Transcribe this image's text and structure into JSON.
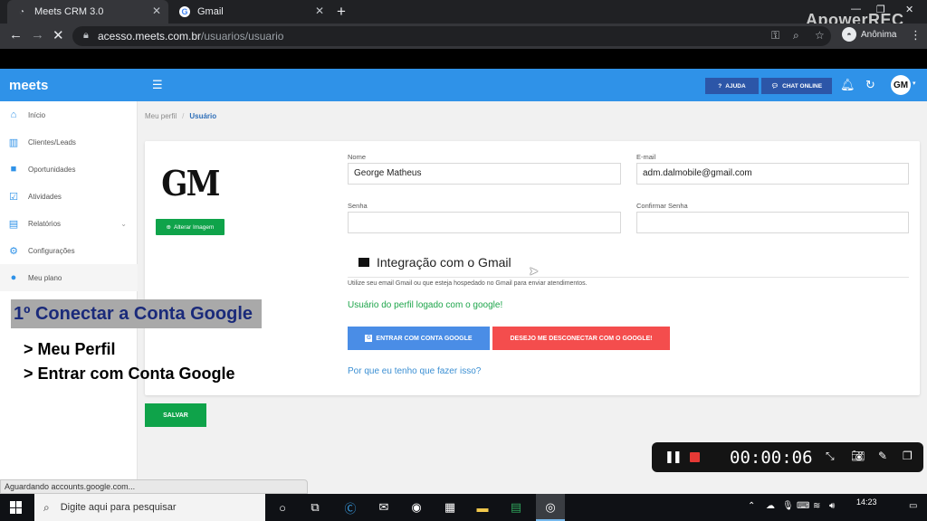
{
  "browser": {
    "tabs": [
      {
        "title": "Meets CRM 3.0"
      },
      {
        "title": "Gmail"
      }
    ],
    "url_host": "acesso.meets.com.br",
    "url_path": "/usuarios/usuario",
    "incognito_label": "Anônima",
    "watermark": "ApowerREC",
    "status_text": "Aguardando accounts.google.com..."
  },
  "app": {
    "brand": "meets",
    "accent_color": "#2f92e8",
    "sidebar": {
      "items": [
        {
          "label": "Início",
          "icon": "home-icon"
        },
        {
          "label": "Clientes/Leads",
          "icon": "clients-icon"
        },
        {
          "label": "Oportunidades",
          "icon": "briefcase-icon"
        },
        {
          "label": "Atividades",
          "icon": "check-shield-icon"
        },
        {
          "label": "Relatórios",
          "icon": "bar-chart-icon"
        },
        {
          "label": "Configurações",
          "icon": "gear-icon"
        },
        {
          "label": "Meu plano",
          "icon": "user-icon"
        }
      ]
    },
    "header": {
      "help_label": "AJUDA",
      "chat_label": "CHAT ONLINE",
      "avatar_initials": "GM"
    },
    "breadcrumb": {
      "parent": "Meu perfil",
      "current": "Usuário"
    },
    "profile": {
      "logo_text": "GM",
      "change_image_label": "Alterar Imagem",
      "name_label": "Nome",
      "name_value": "George Matheus",
      "email_label": "E-mail",
      "email_value": "adm.dalmobile@gmail.com",
      "password_label": "Senha",
      "confirm_password_label": "Confirmar Senha"
    },
    "gmail": {
      "title": "Integração com o Gmail",
      "hint": "Utilize seu email Gmail ou que esteja hospedado no Gmail para enviar atendimentos.",
      "status": "Usuário do perfil logado com o google!",
      "status_color": "#1ea54b",
      "connect_label": "ENTRAR COM CONTA GOOGLE",
      "disconnect_label": "DESEJO ME DESCONECTAR COM O GOOGLE!",
      "why_link": "Por que eu tenho que fazer isso?"
    },
    "save_label": "SALVAR"
  },
  "overlay": {
    "title": "1º Conectar a Conta Google",
    "line1": "> Meu Perfil",
    "line2": "> Entrar com Conta Google"
  },
  "recorder": {
    "time": "00:00:06"
  },
  "taskbar": {
    "search_placeholder": "Digite aqui para pesquisar",
    "time": "14:23"
  }
}
